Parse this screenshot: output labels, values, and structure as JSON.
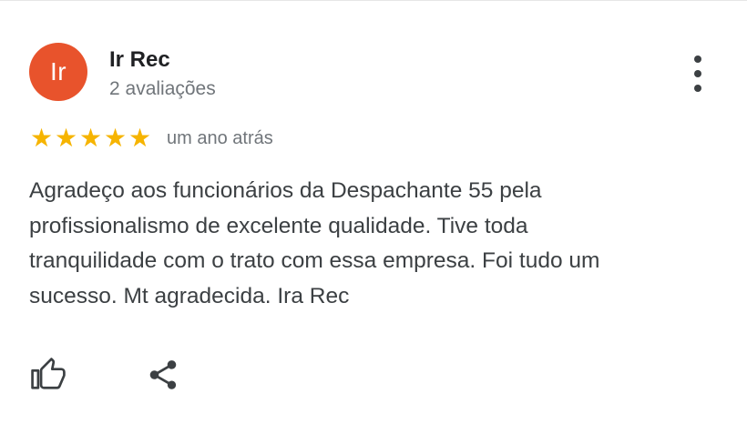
{
  "review": {
    "author": {
      "initials": "Ir",
      "name": "Ir Rec",
      "reviews_count": "2 avaliações",
      "avatar_color": "#e8532c"
    },
    "rating": 5,
    "max_rating": 5,
    "star_color": "#f6b400",
    "date": "um ano atrás",
    "text": "Agradeço aos funcionários da Despachante 55 pela\nprofissionalismo de excelente qualidade. Tive toda\ntranquilidade com o trato com essa empresa. Foi tudo um\nsucesso. Mt agradecida. Ira Rec"
  },
  "icons": {
    "more": "more-vert-icon",
    "like": "thumb-up-outline-icon",
    "share": "share-icon"
  }
}
